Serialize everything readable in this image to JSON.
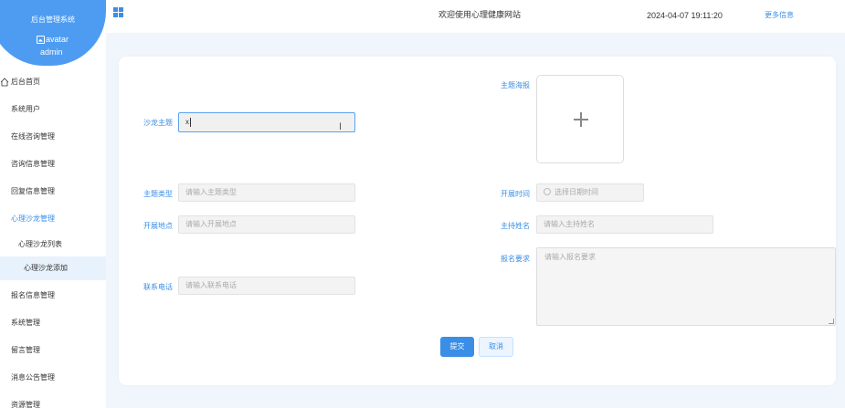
{
  "sidebar": {
    "brand_title": "后台管理系统",
    "avatar_alt": "avatar",
    "username": "admin",
    "home_label": "后台首页",
    "items": [
      {
        "label": "系统用户"
      },
      {
        "label": "在线咨询管理"
      },
      {
        "label": "咨询信息管理"
      },
      {
        "label": "回复信息管理"
      },
      {
        "label": "心理沙龙管理"
      }
    ],
    "submenu": [
      {
        "label": "心理沙龙列表"
      },
      {
        "label": "心理沙龙添加"
      }
    ],
    "items_after": [
      {
        "label": "报名信息管理"
      },
      {
        "label": "系统管理"
      },
      {
        "label": "留言管理"
      },
      {
        "label": "消息公告管理"
      },
      {
        "label": "资源管理"
      }
    ]
  },
  "header": {
    "site_title": "欢迎使用心理健康网站",
    "datetime": "2024-04-07 19:11:20",
    "more_link": "更多信息"
  },
  "form": {
    "salon_topic": {
      "label": "沙龙主题",
      "value": "x"
    },
    "topic_poster": {
      "label": "主题海报"
    },
    "topic_type": {
      "label": "主题类型",
      "placeholder": "请输入主题类型"
    },
    "start_time": {
      "label": "开展时间",
      "placeholder": "选择日期时间"
    },
    "location": {
      "label": "开展地点",
      "placeholder": "请输入开展地点"
    },
    "host_name": {
      "label": "主持姓名",
      "placeholder": "请输入主持姓名"
    },
    "signup_req": {
      "label": "报名要求",
      "placeholder": "请输入报名要求"
    },
    "phone": {
      "label": "联系电话",
      "placeholder": "请输入联系电话"
    },
    "submit_label": "提交",
    "cancel_label": "取消"
  },
  "colors": {
    "accent": "#3a8ee6",
    "brand": "#4e9cf2",
    "page_bg": "#f1f6fd"
  }
}
